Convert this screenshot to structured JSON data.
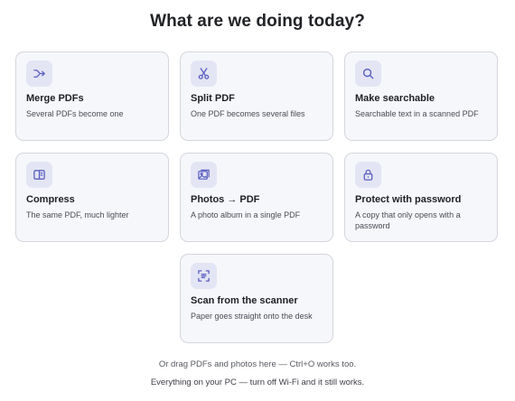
{
  "page": {
    "title": "What are we doing today?"
  },
  "colors": {
    "accent": "#5b5fc0",
    "icon_bg": "#e4e5f4",
    "card_bg": "#f6f7fb",
    "card_border": "#d5d6dd"
  },
  "tools": [
    {
      "icon": "merge-icon",
      "label": "Merge PDFs",
      "description": "Several PDFs become one"
    },
    {
      "icon": "scissors-icon",
      "label": "Split PDF",
      "description": "One PDF becomes several files"
    },
    {
      "icon": "search-icon",
      "label": "Make searchable",
      "description": "Searchable text in a scanned PDF"
    },
    {
      "icon": "compress-icon",
      "label": "Compress",
      "description": "The same PDF, much lighter"
    },
    {
      "icon": "photo-album-icon",
      "label": "Photos → PDF",
      "description": "A photo album in a single PDF"
    },
    {
      "icon": "lock-icon",
      "label": "Protect with password",
      "description": "A copy that only opens with a password"
    },
    {
      "icon": "scan-icon",
      "label": "Scan from the scanner",
      "description": "Paper goes straight onto the desk"
    }
  ],
  "footer": {
    "hint": "Or drag PDFs and photos here — Ctrl+O works too.",
    "privacy": "Everything on your PC — turn off Wi-Fi and it still works."
  }
}
